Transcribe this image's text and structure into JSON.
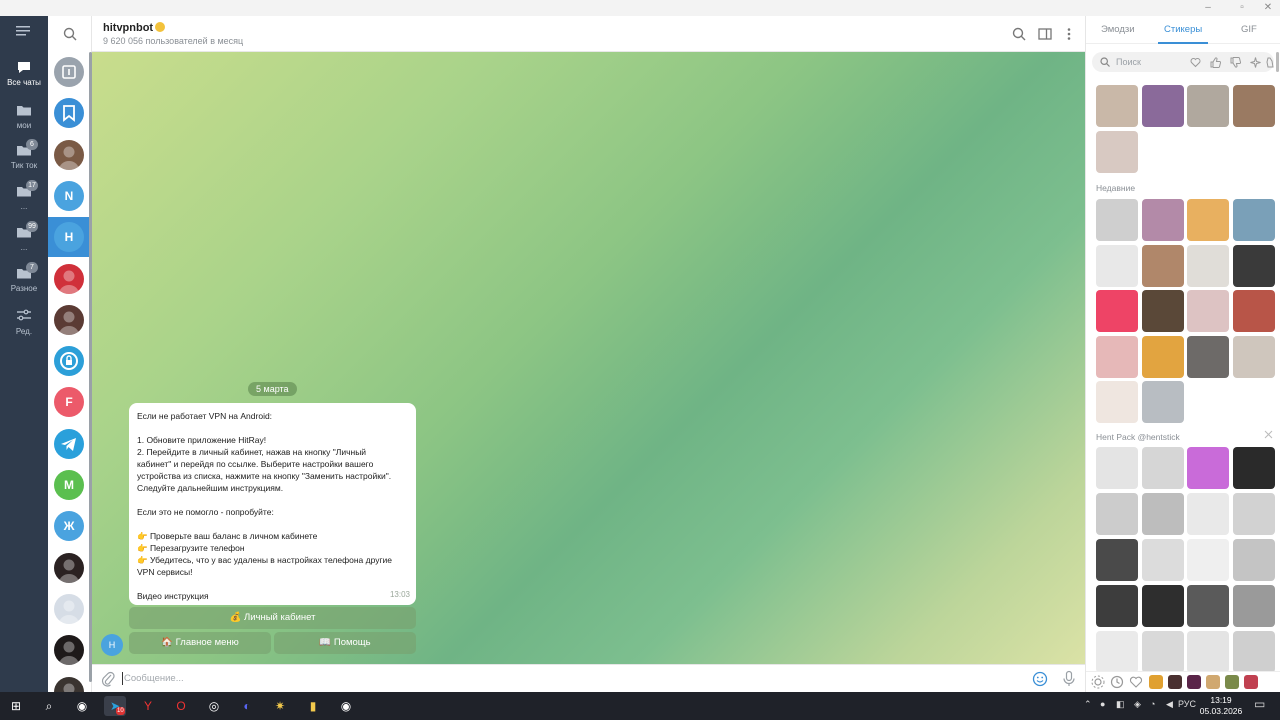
{
  "window": {
    "minimize_icon": "minimize-icon",
    "maximize_icon": "maximize-icon",
    "close_icon": "close-icon"
  },
  "folders": [
    {
      "label": "Все чаты",
      "icon": "chat-bubble-icon",
      "active": true,
      "badge": ""
    },
    {
      "label": "мои",
      "icon": "folder-icon",
      "badge": ""
    },
    {
      "label": "Тик ток",
      "icon": "folder-icon",
      "badge": "6"
    },
    {
      "label": "...",
      "icon": "folder-icon",
      "badge": "17"
    },
    {
      "label": "...",
      "icon": "folder-icon",
      "badge": "99"
    },
    {
      "label": "Разное",
      "icon": "folder-icon",
      "badge": "7"
    },
    {
      "label": "Ред.",
      "icon": "sliders-icon",
      "badge": ""
    }
  ],
  "chatlist": {
    "avatars": [
      {
        "letter": "",
        "color": "#9aa3ad",
        "kind": "archive"
      },
      {
        "letter": "",
        "color": "#3a8fd6",
        "kind": "saved"
      },
      {
        "letter": "",
        "color": "#7a5a45",
        "kind": "photo"
      },
      {
        "letter": "N",
        "color": "#4aa3df",
        "kind": "letter"
      },
      {
        "letter": "H",
        "color": "#4aa3df",
        "kind": "letter"
      },
      {
        "letter": "",
        "color": "#d0303a",
        "kind": "photo"
      },
      {
        "letter": "",
        "color": "#5b3b34",
        "kind": "photo"
      },
      {
        "letter": "",
        "color": "#2c9fd8",
        "kind": "lock"
      },
      {
        "letter": "F",
        "color": "#ec5a6a",
        "kind": "letter"
      },
      {
        "letter": "",
        "color": "#2aa0db",
        "kind": "telegram"
      },
      {
        "letter": "M",
        "color": "#5bbf4f",
        "kind": "letter"
      },
      {
        "letter": "Ж",
        "color": "#4aa3df",
        "kind": "letter"
      },
      {
        "letter": "",
        "color": "#2b2222",
        "kind": "photo"
      },
      {
        "letter": "",
        "color": "#d6dde6",
        "kind": "photo"
      },
      {
        "letter": "",
        "color": "#1e1a1a",
        "kind": "photo"
      },
      {
        "letter": "",
        "color": "#3a3430",
        "kind": "photo"
      }
    ]
  },
  "header": {
    "title": "hitvpnbot",
    "subtitle": "9 620 056 пользователей в месяц"
  },
  "chat": {
    "date_pill": "5 марта",
    "message_lines": [
      "Если не работает VPN на Android:",
      "",
      "1. Обновите приложение HitRay!",
      "2. Перейдите в личный кабинет, нажав на кнопку \"Личный",
      "кабинет\" и перейдя по ссылке. Выберите настройки вашего",
      "устройства из списка, нажмите на кнопку \"Заменить настройки\".",
      "Следуйте дальнейшим инструкциям.",
      "",
      "Если это не помогло - попробуйте:",
      "",
      "👉 Проверьте ваш баланс в личном кабинете",
      "👉 Перезагрузите телефон",
      "👉 Убедитесь, что у вас удалены в настройках телефона другие",
      "VPN сервисы!",
      "",
      "Видео инструкция"
    ],
    "message_time": "13:03",
    "buttons": {
      "cabinet": "💰 Личный кабинет",
      "main_menu": "🏠 Главное меню",
      "help": "📖 Помощь"
    },
    "bot_avatar_letter": "H"
  },
  "composer": {
    "placeholder": "Сообщение..."
  },
  "stickers": {
    "tabs": [
      "Эмодзи",
      "Стикеры",
      "GIF"
    ],
    "active_tab": "Стикеры",
    "search_placeholder": "Поиск",
    "section_recent": "Недавние",
    "section_pack": "Hent Pack @hentstick",
    "top": [
      {
        "name": "sticker-woman-cap",
        "color": "#c9b8a8"
      },
      {
        "name": "sticker-anime-girl",
        "color": "#8a6a9a"
      },
      {
        "name": "sticker-cat-white",
        "color": "#b0a89e"
      },
      {
        "name": "sticker-cat-face",
        "color": "#9a7a62"
      },
      {
        "name": "sticker-cat-close",
        "color": "#d8c9c2"
      }
    ],
    "recent": [
      {
        "name": "sticker-manga",
        "color": "#cfcfcf"
      },
      {
        "name": "sticker-cat-pink",
        "color": "#b38aa8"
      },
      {
        "name": "sticker-shiba",
        "color": "#e8b060"
      },
      {
        "name": "sticker-wave",
        "color": "#7aa0b8"
      },
      {
        "name": "sticker-bear",
        "color": "#e8e8e8"
      },
      {
        "name": "sticker-man",
        "color": "#b0876a"
      },
      {
        "name": "sticker-cats-cute",
        "color": "#e0ddd8"
      },
      {
        "name": "sticker-black-cat",
        "color": "#3a3a3a"
      },
      {
        "name": "sticker-heart",
        "color": "#ee4466"
      },
      {
        "name": "sticker-man-dark",
        "color": "#5a4838"
      },
      {
        "name": "sticker-pig",
        "color": "#ddc3c3"
      },
      {
        "name": "sticker-cat-red",
        "color": "#b85548"
      },
      {
        "name": "sticker-face-pink",
        "color": "#e6b8b8"
      },
      {
        "name": "sticker-doge",
        "color": "#e2a440"
      },
      {
        "name": "sticker-cat-gray",
        "color": "#6d6a68"
      },
      {
        "name": "sticker-cat-smirk",
        "color": "#cfc6bd"
      },
      {
        "name": "sticker-cat-yell",
        "color": "#efe6e0"
      },
      {
        "name": "sticker-hand",
        "color": "#b8bdc2"
      }
    ],
    "pack": [
      {
        "name": "pack-1",
        "color": "#e4e4e4"
      },
      {
        "name": "pack-2",
        "color": "#d6d6d6"
      },
      {
        "name": "pack-3",
        "color": "#c96bd9"
      },
      {
        "name": "pack-4",
        "color": "#2a2a2a"
      },
      {
        "name": "pack-5",
        "color": "#cccccc"
      },
      {
        "name": "pack-6",
        "color": "#bdbdbd"
      },
      {
        "name": "pack-7",
        "color": "#e9e9e9"
      },
      {
        "name": "pack-8",
        "color": "#d2d2d2"
      },
      {
        "name": "pack-9",
        "color": "#4a4a4a"
      },
      {
        "name": "pack-10",
        "color": "#dcdcdc"
      },
      {
        "name": "pack-11",
        "color": "#efefef"
      },
      {
        "name": "pack-12",
        "color": "#c4c4c4"
      },
      {
        "name": "pack-13",
        "color": "#3d3d3d"
      },
      {
        "name": "pack-14",
        "color": "#2e2e2e"
      },
      {
        "name": "pack-15",
        "color": "#5a5a5a"
      },
      {
        "name": "pack-16",
        "color": "#9a9a9a"
      },
      {
        "name": "pack-17",
        "color": "#eaeaea"
      },
      {
        "name": "pack-18",
        "color": "#d9d9d9"
      },
      {
        "name": "pack-19",
        "color": "#e4e4e4"
      },
      {
        "name": "pack-20",
        "color": "#cfcfcf"
      }
    ],
    "tray": [
      "#e0a030",
      "#4a3030",
      "#5a2448",
      "#d0a870",
      "#7a8a4a",
      "#c04050"
    ]
  },
  "taskbar": {
    "apps": [
      "windows-start-icon",
      "search-icon",
      "steam-icon",
      "telegram-icon",
      "yandex-icon",
      "opera-icon",
      "chrome-icon",
      "discord-icon",
      "star-app-icon",
      "folder-app-icon",
      "steam-app-icon"
    ],
    "telegram_badge": "10",
    "lang": "РУС",
    "time": "13:19",
    "date": "05.03.2026"
  },
  "colors": {
    "accent": "#3a8fd6",
    "folders_bg": "#2f3b4c",
    "taskbar_bg": "#1f2229"
  }
}
